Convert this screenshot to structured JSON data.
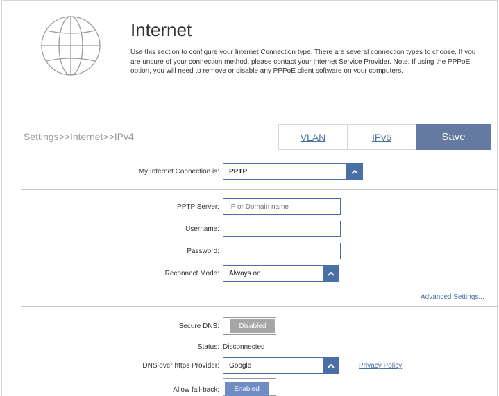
{
  "header": {
    "title": "Internet",
    "description": "Use this section to configure your Internet Connection type. There are several connection types to choose. If you are unsure of your connection method, please contact your Internet Service Provider. Note: If using the PPPoE option, you will need to remove or disable any PPPoE client software on your computers."
  },
  "nav": {
    "breadcrumb": "Settings>>Internet>>IPv4",
    "tab_vlan": "VLAN",
    "tab_ipv6": "IPv6",
    "save_label": "Save"
  },
  "connection": {
    "label": "My Internet Connection is:",
    "value": "PPTP"
  },
  "pptp": {
    "server_label": "PPTP Server:",
    "server_placeholder": "IP or Domain name",
    "username_label": "Username:",
    "password_label": "Password:",
    "reconnect_label": "Reconnect Mode:",
    "reconnect_value": "Always on",
    "advanced_link": "Advanced Settings..."
  },
  "dns": {
    "secure_label": "Secure DNS:",
    "secure_state": "Disabled",
    "status_label": "Status:",
    "status_value": "Disconnected",
    "provider_label": "DNS over https Provider:",
    "provider_value": "Google",
    "privacy_link": "Privacy Policy",
    "fallback_label": "Allow fall-back:",
    "fallback_state": "Enabled"
  },
  "colors": {
    "accent": "#4a6fa5",
    "save_bg": "#647aa0",
    "disabled_toggle": "#a6a6a6",
    "enabled_toggle": "#6f8cc4"
  }
}
